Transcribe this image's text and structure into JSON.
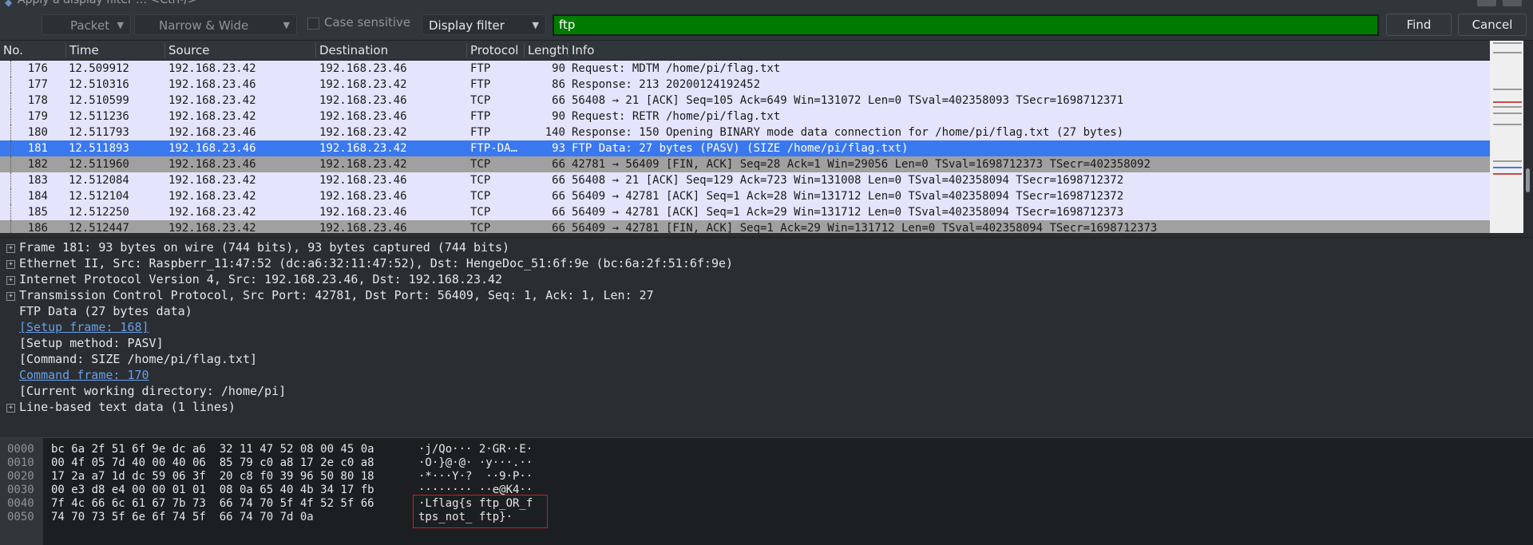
{
  "window": {
    "title": "Apply a display filter … <Ctrl-/>"
  },
  "toolbar": {
    "search_in": "Packet list",
    "char_width": "Narrow & Wide",
    "case_sensitive": "Case sensitive",
    "search_type": "Display filter",
    "filter_value": "ftp",
    "find_label": "Find",
    "cancel_label": "Cancel"
  },
  "packet_list": {
    "columns": [
      "No.",
      "Time",
      "Source",
      "Destination",
      "Protocol",
      "Length",
      "Info"
    ],
    "rows": [
      {
        "no": "176",
        "time": "12.509912",
        "src": "192.168.23.42",
        "dst": "192.168.23.46",
        "proto": "FTP",
        "len": "90",
        "info": "Request: MDTM /home/pi/flag.txt",
        "style": "ftp"
      },
      {
        "no": "177",
        "time": "12.510316",
        "src": "192.168.23.46",
        "dst": "192.168.23.42",
        "proto": "FTP",
        "len": "86",
        "info": "Response: 213 20200124192452",
        "style": "ftp"
      },
      {
        "no": "178",
        "time": "12.510599",
        "src": "192.168.23.42",
        "dst": "192.168.23.46",
        "proto": "TCP",
        "len": "66",
        "info": "56408 → 21 [ACK] Seq=105 Ack=649 Win=131072 Len=0 TSval=402358093 TSecr=1698712371",
        "style": "tcp"
      },
      {
        "no": "179",
        "time": "12.511236",
        "src": "192.168.23.42",
        "dst": "192.168.23.46",
        "proto": "FTP",
        "len": "90",
        "info": "Request: RETR /home/pi/flag.txt",
        "style": "ftp"
      },
      {
        "no": "180",
        "time": "12.511793",
        "src": "192.168.23.46",
        "dst": "192.168.23.42",
        "proto": "FTP",
        "len": "140",
        "info": "Response: 150 Opening BINARY mode data connection for /home/pi/flag.txt (27 bytes)",
        "style": "ftp"
      },
      {
        "no": "181",
        "time": "12.511893",
        "src": "192.168.23.46",
        "dst": "192.168.23.42",
        "proto": "FTP-DA…",
        "len": "93",
        "info": "FTP Data: 27 bytes (PASV) (SIZE /home/pi/flag.txt)",
        "style": "sel"
      },
      {
        "no": "182",
        "time": "12.511960",
        "src": "192.168.23.46",
        "dst": "192.168.23.42",
        "proto": "TCP",
        "len": "66",
        "info": "42781 → 56409 [FIN, ACK] Seq=28 Ack=1 Win=29056 Len=0 TSval=1698712373 TSecr=402358092",
        "style": "fin"
      },
      {
        "no": "183",
        "time": "12.512084",
        "src": "192.168.23.42",
        "dst": "192.168.23.46",
        "proto": "TCP",
        "len": "66",
        "info": "56408 → 21 [ACK] Seq=129 Ack=723 Win=131008 Len=0 TSval=402358094 TSecr=1698712372",
        "style": "tcp"
      },
      {
        "no": "184",
        "time": "12.512104",
        "src": "192.168.23.42",
        "dst": "192.168.23.46",
        "proto": "TCP",
        "len": "66",
        "info": "56409 → 42781 [ACK] Seq=1 Ack=28 Win=131712 Len=0 TSval=402358094 TSecr=1698712372",
        "style": "tcp"
      },
      {
        "no": "185",
        "time": "12.512250",
        "src": "192.168.23.42",
        "dst": "192.168.23.46",
        "proto": "TCP",
        "len": "66",
        "info": "56409 → 42781 [ACK] Seq=1 Ack=29 Win=131712 Len=0 TSval=402358094 TSecr=1698712373",
        "style": "tcp"
      },
      {
        "no": "186",
        "time": "12.512447",
        "src": "192.168.23.42",
        "dst": "192.168.23.46",
        "proto": "TCP",
        "len": "66",
        "info": "56409 → 42781 [FIN, ACK] Seq=1 Ack=29 Win=131712 Len=0 TSval=402358094 TSecr=1698712373",
        "style": "fin"
      }
    ]
  },
  "details": [
    {
      "text": "Frame 181: 93 bytes on wire (744 bits), 93 bytes captured (744 bits)",
      "expandable": true,
      "indent": 0,
      "link": false
    },
    {
      "text": "Ethernet II, Src: Raspberr_11:47:52 (dc:a6:32:11:47:52), Dst: HengeDoc_51:6f:9e (bc:6a:2f:51:6f:9e)",
      "expandable": true,
      "indent": 0,
      "link": false
    },
    {
      "text": "Internet Protocol Version 4, Src: 192.168.23.46, Dst: 192.168.23.42",
      "expandable": true,
      "indent": 0,
      "link": false
    },
    {
      "text": "Transmission Control Protocol, Src Port: 42781, Dst Port: 56409, Seq: 1, Ack: 1, Len: 27",
      "expandable": true,
      "indent": 0,
      "link": false
    },
    {
      "text": "FTP Data (27 bytes data)",
      "expandable": false,
      "indent": 0,
      "link": false
    },
    {
      "text": "[Setup frame: 168]",
      "expandable": false,
      "indent": 0,
      "link": true
    },
    {
      "text": "[Setup method: PASV]",
      "expandable": false,
      "indent": 0,
      "link": false
    },
    {
      "text": "[Command: SIZE /home/pi/flag.txt]",
      "expandable": false,
      "indent": 0,
      "link": false
    },
    {
      "text": "Command frame: 170",
      "expandable": false,
      "indent": 0,
      "link": true
    },
    {
      "text": "[Current working directory: /home/pi]",
      "expandable": false,
      "indent": 0,
      "link": false
    },
    {
      "text": "Line-based text data (1 lines)",
      "expandable": true,
      "indent": 0,
      "link": false
    }
  ],
  "bytes": [
    {
      "offset": "0000",
      "hex": "bc 6a 2f 51 6f 9e dc a6  32 11 47 52 08 00 45 0a",
      "ascii": "·j/Qo··· 2·GR··E·"
    },
    {
      "offset": "0010",
      "hex": "00 4f 05 7d 40 00 40 06  85 79 c0 a8 17 2e c0 a8",
      "ascii": "·O·}@·@· ·y···.··"
    },
    {
      "offset": "0020",
      "hex": "17 2a a7 1d dc 59 06 3f  20 c8 f0 39 96 50 80 18",
      "ascii": "·*···Y·?  ··9·P··"
    },
    {
      "offset": "0030",
      "hex": "00 e3 d8 e4 00 00 01 01  08 0a 65 40 4b 34 17 fb",
      "ascii": "········ ··e@K4··"
    },
    {
      "offset": "0040",
      "hex": "7f 4c 66 6c 61 67 7b 73  66 74 70 5f 4f 52 5f 66",
      "ascii": "·Lflag{s ftp_OR_f"
    },
    {
      "offset": "0050",
      "hex": "74 70 73 5f 6e 6f 74 5f  66 74 70 7d 0a",
      "ascii": "tps_not_ ftp}·"
    }
  ]
}
